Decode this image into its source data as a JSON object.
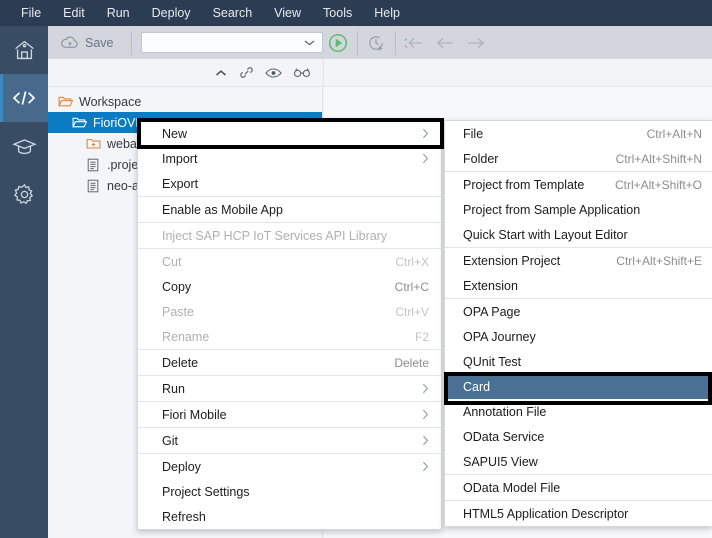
{
  "menubar": {
    "items": [
      {
        "label": "File"
      },
      {
        "label": "Edit"
      },
      {
        "label": "Run"
      },
      {
        "label": "Deploy"
      },
      {
        "label": "Search"
      },
      {
        "label": "View"
      },
      {
        "label": "Tools"
      },
      {
        "label": "Help"
      }
    ]
  },
  "rail": {
    "items": [
      {
        "icon": "home-icon",
        "active": false
      },
      {
        "icon": "code-icon",
        "active": true
      },
      {
        "icon": "graduation-cap-icon",
        "active": false
      },
      {
        "icon": "gear-icon",
        "active": false
      }
    ]
  },
  "toolbar": {
    "save_label": "Save",
    "save_icon": "cloud-save-icon",
    "run_config_value": "",
    "run_config_placeholder": "",
    "run_icon": "run-play-icon",
    "debug_icon": "run-history-icon",
    "step_into_icon": "step-into-icon",
    "step_back_icon": "arrow-left-icon",
    "step_forward_icon": "arrow-right-icon"
  },
  "subbar": {
    "collapse_icon": "chevron-up-icon",
    "link_icon": "link-icon",
    "preview_icon": "eye-icon",
    "inspect_icon": "glasses-icon"
  },
  "explorer": {
    "tree": [
      {
        "label": "Workspace",
        "icon": "folder-open-icon",
        "indent": 0,
        "selected": false
      },
      {
        "label": "FioriOVP",
        "icon": "folder-open-white-icon",
        "indent": 1,
        "selected": true
      },
      {
        "label": "webapp",
        "icon": "folder-plus-icon",
        "indent": 2,
        "selected": false
      },
      {
        "label": ".project.json",
        "icon": "file-icon",
        "indent": 2,
        "selected": false
      },
      {
        "label": "neo-app.json",
        "icon": "file-icon",
        "indent": 2,
        "selected": false
      }
    ]
  },
  "context_menu": {
    "groups": [
      [
        {
          "label": "New",
          "accel": "",
          "arrow": true,
          "disabled": false,
          "highlighted": true
        },
        {
          "label": "Import",
          "accel": "",
          "arrow": true,
          "disabled": false,
          "highlighted": false
        },
        {
          "label": "Export",
          "accel": "",
          "arrow": false,
          "disabled": false,
          "highlighted": false
        }
      ],
      [
        {
          "label": "Enable as Mobile App",
          "accel": "",
          "arrow": false,
          "disabled": false,
          "highlighted": false
        }
      ],
      [
        {
          "label": "Inject SAP HCP IoT Services API Library",
          "accel": "",
          "arrow": false,
          "disabled": true,
          "highlighted": false
        }
      ],
      [
        {
          "label": "Cut",
          "accel": "Ctrl+X",
          "arrow": false,
          "disabled": true,
          "highlighted": false
        },
        {
          "label": "Copy",
          "accel": "Ctrl+C",
          "arrow": false,
          "disabled": false,
          "highlighted": false
        },
        {
          "label": "Paste",
          "accel": "Ctrl+V",
          "arrow": false,
          "disabled": true,
          "highlighted": false
        },
        {
          "label": "Rename",
          "accel": "F2",
          "arrow": false,
          "disabled": true,
          "highlighted": false
        }
      ],
      [
        {
          "label": "Delete",
          "accel": "Delete",
          "arrow": false,
          "disabled": false,
          "highlighted": false
        }
      ],
      [
        {
          "label": "Run",
          "accel": "",
          "arrow": true,
          "disabled": false,
          "highlighted": false
        }
      ],
      [
        {
          "label": "Fiori Mobile",
          "accel": "",
          "arrow": true,
          "disabled": false,
          "highlighted": false
        }
      ],
      [
        {
          "label": "Git",
          "accel": "",
          "arrow": true,
          "disabled": false,
          "highlighted": false
        }
      ],
      [
        {
          "label": "Deploy",
          "accel": "",
          "arrow": true,
          "disabled": false,
          "highlighted": false
        },
        {
          "label": "Project Settings",
          "accel": "",
          "arrow": false,
          "disabled": false,
          "highlighted": false
        },
        {
          "label": "Refresh",
          "accel": "",
          "arrow": false,
          "disabled": false,
          "highlighted": false
        }
      ]
    ]
  },
  "submenu": {
    "groups": [
      [
        {
          "label": "File",
          "accel": "Ctrl+Alt+N",
          "highlighted": false
        },
        {
          "label": "Folder",
          "accel": "Ctrl+Alt+Shift+N",
          "highlighted": false
        }
      ],
      [
        {
          "label": "Project from Template",
          "accel": "Ctrl+Alt+Shift+O",
          "highlighted": false
        },
        {
          "label": "Project from Sample Application",
          "accel": "",
          "highlighted": false
        },
        {
          "label": "Quick Start with Layout Editor",
          "accel": "",
          "highlighted": false
        }
      ],
      [
        {
          "label": "Extension Project",
          "accel": "Ctrl+Alt+Shift+E",
          "highlighted": false
        },
        {
          "label": "Extension",
          "accel": "",
          "highlighted": false
        }
      ],
      [
        {
          "label": "OPA Page",
          "accel": "",
          "highlighted": false
        },
        {
          "label": "OPA Journey",
          "accel": "",
          "highlighted": false
        },
        {
          "label": "QUnit Test",
          "accel": "",
          "highlighted": false
        },
        {
          "label": "Card",
          "accel": "",
          "highlighted": true
        },
        {
          "label": "Annotation File",
          "accel": "",
          "highlighted": false
        },
        {
          "label": "OData Service",
          "accel": "",
          "highlighted": false
        },
        {
          "label": "SAPUI5 View",
          "accel": "",
          "highlighted": false
        }
      ],
      [
        {
          "label": "OData Model File",
          "accel": "",
          "highlighted": false
        }
      ],
      [
        {
          "label": "HTML5 Application Descriptor",
          "accel": "",
          "highlighted": false
        }
      ]
    ]
  },
  "colors": {
    "menubar_bg": "#2c3c52",
    "rail_bg": "#384d63",
    "rail_active_bg": "#476a8c",
    "toolbar_bg": "#d3d7dd",
    "tree_selected_bg": "#0c7cc2",
    "submenu_highlight_bg": "#4a7093",
    "annotation_border": "#000000",
    "run_icon_green": "#5bbd6b",
    "folder_icon_orange": "#e8833a"
  }
}
